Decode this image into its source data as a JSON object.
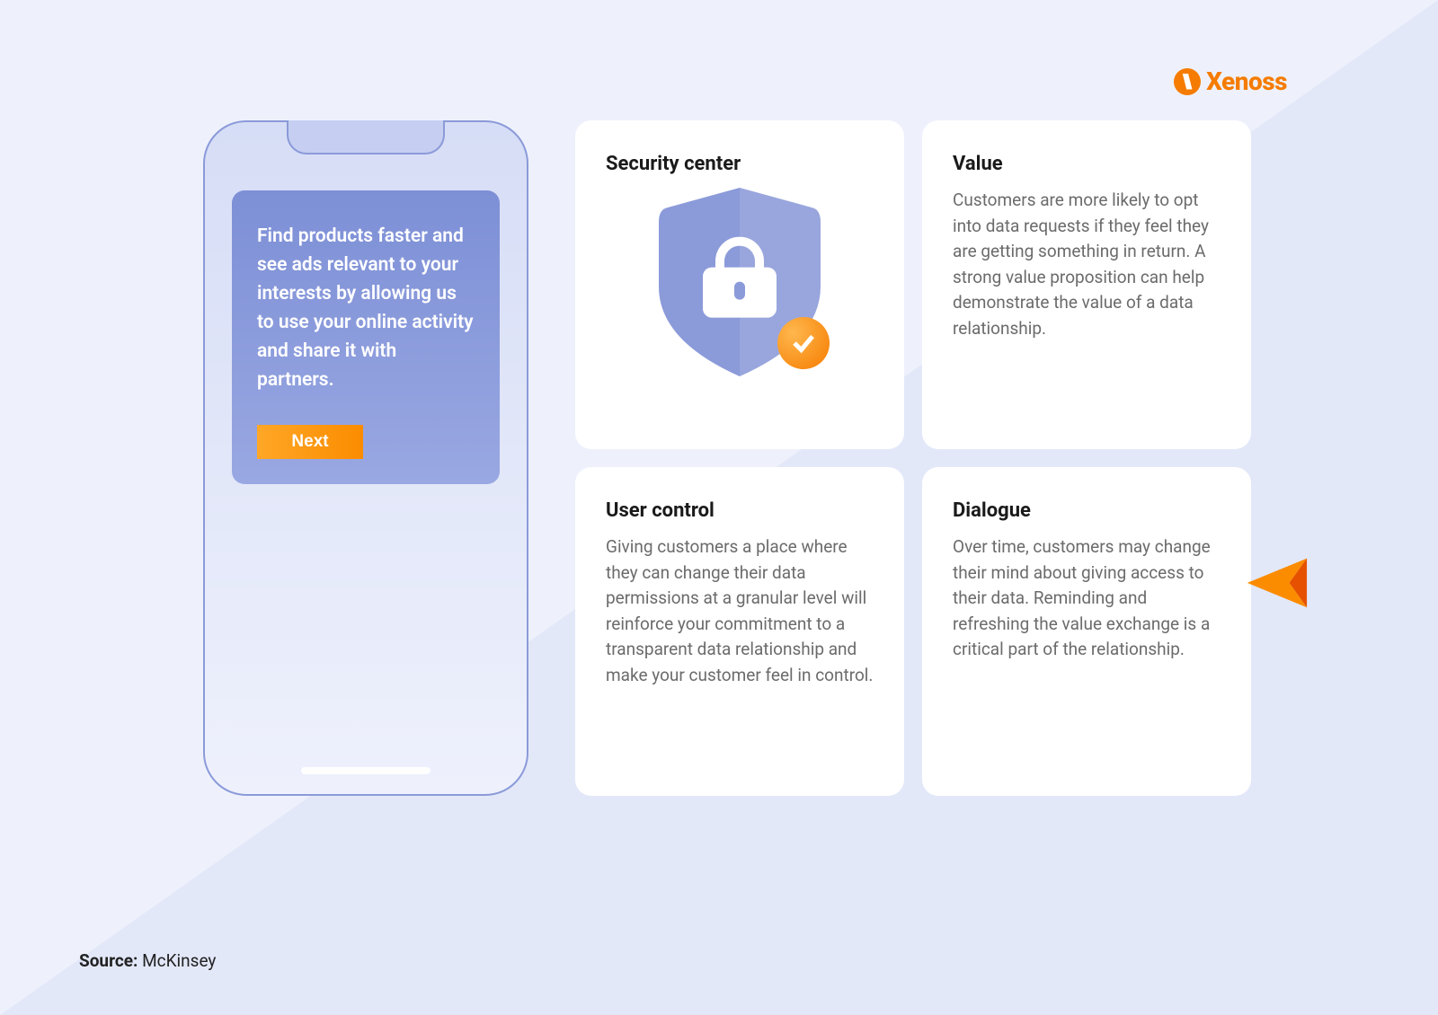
{
  "brand": {
    "name": "Xenoss"
  },
  "phone": {
    "prompt_text": "Find products faster and see ads relevant to your interests by allowing us to use your online activity and share it with partners.",
    "next_label": "Next"
  },
  "cards": {
    "security": {
      "title": "Security center"
    },
    "value": {
      "title": "Value",
      "body": "Customers are more likely to opt into data requests if they feel they are getting something in return. A strong value proposition can help demonstrate the value of a data relationship."
    },
    "user_control": {
      "title": "User control",
      "body": "Giving customers a place where they can change their data permissions at a granular level will reinforce your commitment to a transparent data relationship and make your customer feel in control."
    },
    "dialogue": {
      "title": "Dialogue",
      "body": "Over time, customers may change their mind about giving access to their data. Reminding and refreshing the value exchange is a critical part of the relationship."
    }
  },
  "source": {
    "label": "Source:",
    "value": "McKinsey"
  },
  "colors": {
    "accent": "#f57c00",
    "panel": "#8b9ad9"
  }
}
